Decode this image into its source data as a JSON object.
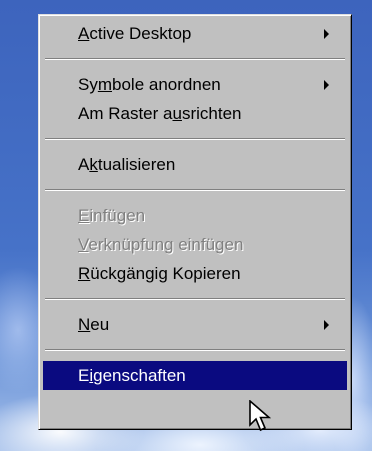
{
  "menu": {
    "items": [
      {
        "pre": "",
        "key": "A",
        "post": "ctive Desktop",
        "submenu": true,
        "disabled": false,
        "selected": false
      },
      {
        "pre": "Sy",
        "key": "m",
        "post": "bole anordnen",
        "submenu": true,
        "disabled": false,
        "selected": false
      },
      {
        "pre": "Am Raster a",
        "key": "u",
        "post": "srichten",
        "submenu": false,
        "disabled": false,
        "selected": false
      },
      {
        "pre": "A",
        "key": "k",
        "post": "tualisieren",
        "submenu": false,
        "disabled": false,
        "selected": false
      },
      {
        "pre": "",
        "key": "E",
        "post": "infügen",
        "submenu": false,
        "disabled": true,
        "selected": false
      },
      {
        "pre": "",
        "key": "V",
        "post": "erknüpfung einfügen",
        "submenu": false,
        "disabled": true,
        "selected": false
      },
      {
        "pre": "",
        "key": "R",
        "post": "ückgängig Kopieren",
        "submenu": false,
        "disabled": false,
        "selected": false
      },
      {
        "pre": "",
        "key": "N",
        "post": "eu",
        "submenu": true,
        "disabled": false,
        "selected": false
      },
      {
        "pre": "E",
        "key": "i",
        "post": "genschaften",
        "submenu": false,
        "disabled": false,
        "selected": true
      }
    ]
  },
  "colors": {
    "menu_face": "#c0c0c0",
    "highlight": "#0a0a80",
    "disabled_text": "#808080",
    "desktop_sky": "#3d64bd"
  },
  "icons": {
    "submenu": "submenu-arrow-icon",
    "pointer": "mouse-pointer-icon"
  }
}
